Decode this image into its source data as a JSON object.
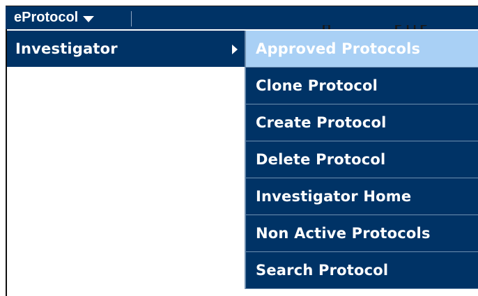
{
  "navbar": {
    "menu_label": "eProtocol"
  },
  "background_fragment": {
    "text_left": "H",
    "text_right": "P  l  l  P"
  },
  "menu": {
    "level1_label": "Investigator",
    "items": [
      {
        "label": "Approved Protocols",
        "active": true
      },
      {
        "label": "Clone Protocol",
        "active": false
      },
      {
        "label": "Create Protocol",
        "active": false
      },
      {
        "label": "Delete Protocol",
        "active": false
      },
      {
        "label": "Investigator Home",
        "active": false
      },
      {
        "label": "Non Active Protocols",
        "active": false
      },
      {
        "label": "Search Protocol",
        "active": false
      }
    ]
  },
  "colors": {
    "navy": "#003366",
    "highlight": "#a9d0f5",
    "divider": "#6f8fb0",
    "text": "#ffffff"
  },
  "icons": {
    "menu_dropdown": "caret-down-icon",
    "submenu_indicator": "caret-right-icon"
  }
}
